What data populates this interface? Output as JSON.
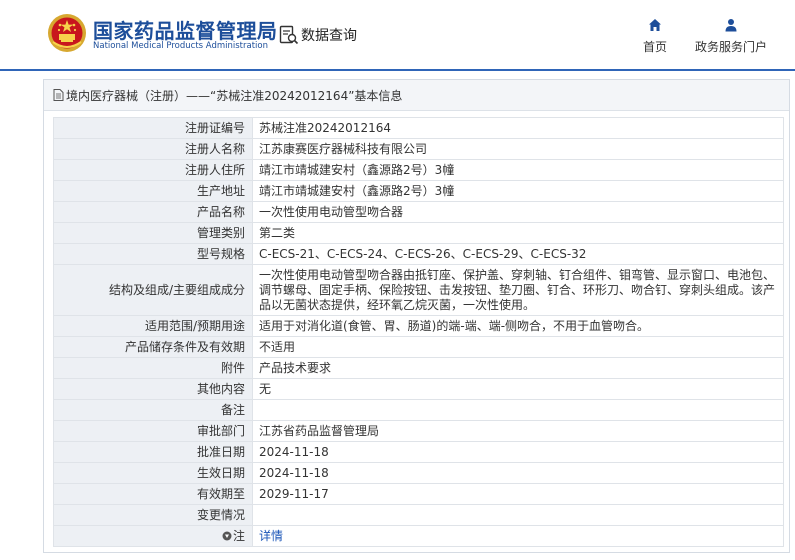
{
  "header": {
    "brand_cn": "国家药品监督管理局",
    "brand_en": "National Medical Products Administration",
    "query_label": "数据查询",
    "nav": {
      "home": "首页",
      "gov_service": "政务服务门户"
    }
  },
  "colors": {
    "brand": "#1d4e9a",
    "accent_line": "#2f65b8",
    "label_bg": "#edf0f4",
    "link": "#1b56b8"
  },
  "icons": {
    "emblem": "national-emblem-icon",
    "query": "data-query-icon",
    "home": "home-icon",
    "user": "user-icon",
    "doc": "document-icon",
    "note": "note-icon"
  },
  "panel": {
    "title": "境内医疗器械（注册）——“苏械注准20242012164”基本信息",
    "rows": [
      {
        "label": "注册证编号",
        "value": "苏械注准20242012164"
      },
      {
        "label": "注册人名称",
        "value": "江苏康赛医疗器械科技有限公司"
      },
      {
        "label": "注册人住所",
        "value": "靖江市靖城建安村（鑫源路2号）3幢"
      },
      {
        "label": "生产地址",
        "value": "靖江市靖城建安村（鑫源路2号）3幢"
      },
      {
        "label": "产品名称",
        "value": "一次性使用电动管型吻合器"
      },
      {
        "label": "管理类别",
        "value": "第二类"
      },
      {
        "label": "型号规格",
        "value": "C-ECS-21、C-ECS-24、C-ECS-26、C-ECS-29、C-ECS-32"
      },
      {
        "label": "结构及组成/主要组成成分",
        "value": "一次性使用电动管型吻合器由抵钉座、保护盖、穿刺轴、钉合组件、钼弯管、显示窗口、电池包、调节螺母、固定手柄、保险按钮、击发按钮、垫刀圈、钉合、环形刀、吻合钉、穿刺头组成。该产品以无菌状态提供，经环氧乙烷灭菌，一次性使用。"
      },
      {
        "label": "适用范围/预期用途",
        "value": "适用于对消化道(食管、胃、肠道)的端-端、端-侧吻合，不用于血管吻合。"
      },
      {
        "label": "产品储存条件及有效期",
        "value": "不适用"
      },
      {
        "label": "附件",
        "value": "产品技术要求"
      },
      {
        "label": "其他内容",
        "value": "无"
      },
      {
        "label": "备注",
        "value": ""
      },
      {
        "label": "审批部门",
        "value": "江苏省药品监督管理局"
      },
      {
        "label": "批准日期",
        "value": "2024-11-18"
      },
      {
        "label": "生效日期",
        "value": "2024-11-18"
      },
      {
        "label": "有效期至",
        "value": "2029-11-17"
      },
      {
        "label": "变更情况",
        "value": ""
      }
    ],
    "note_row": {
      "label": "注",
      "link_text": "详情"
    }
  }
}
